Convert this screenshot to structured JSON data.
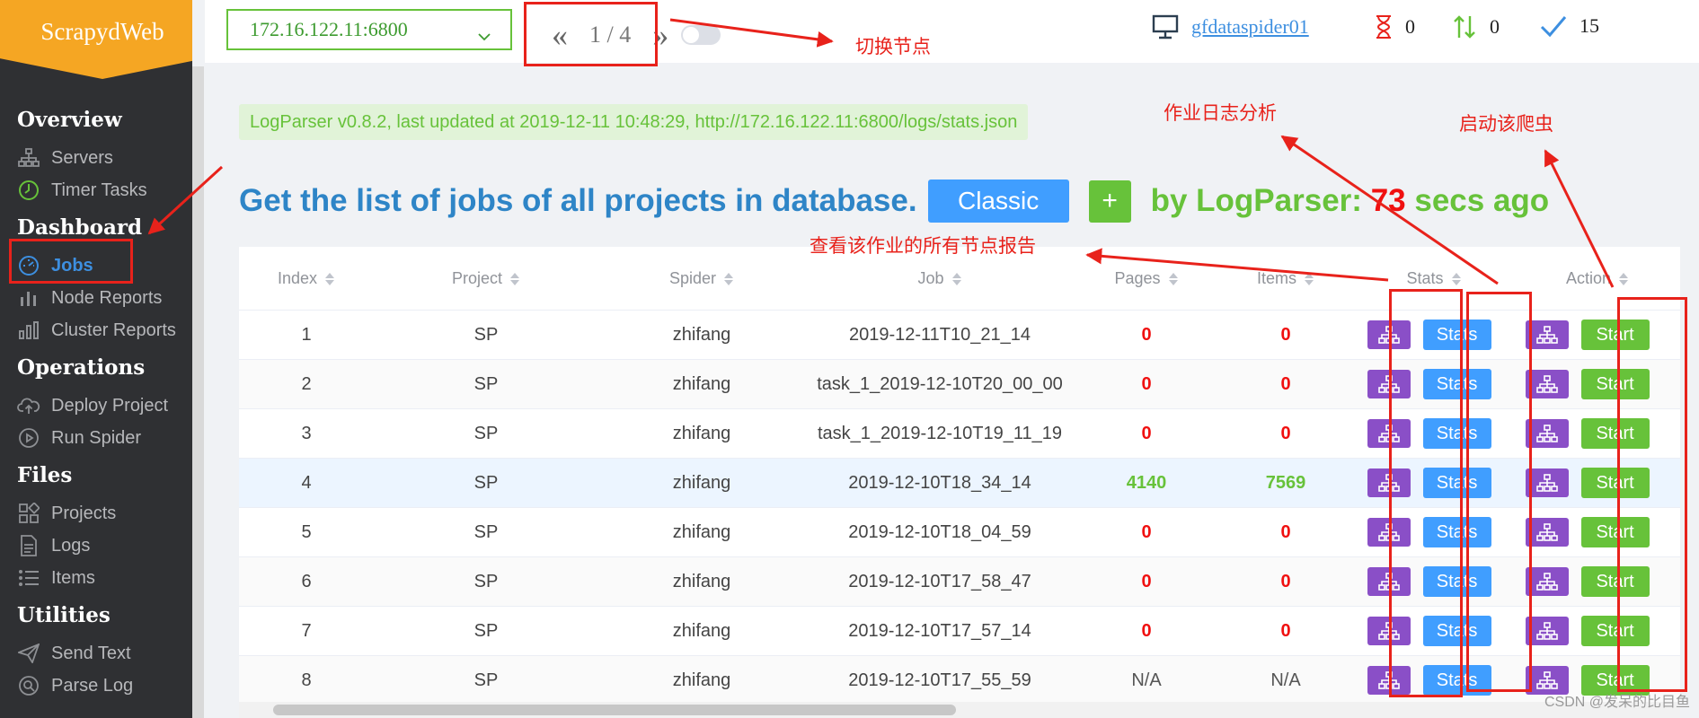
{
  "app": {
    "title": "ScrapydWeb"
  },
  "sidebar": {
    "groups": [
      {
        "label": "Overview",
        "items": [
          {
            "label": "Servers",
            "icon": "sitemap-icon"
          },
          {
            "label": "Timer Tasks",
            "icon": "timer-icon"
          }
        ]
      },
      {
        "label": "Dashboard",
        "items": [
          {
            "label": "Jobs",
            "icon": "dashboard-icon",
            "active": true
          },
          {
            "label": "Node Reports",
            "icon": "bar-chart-icon"
          },
          {
            "label": "Cluster Reports",
            "icon": "bar-chart-icon"
          }
        ]
      },
      {
        "label": "Operations",
        "items": [
          {
            "label": "Deploy Project",
            "icon": "upload-cloud-icon"
          },
          {
            "label": "Run Spider",
            "icon": "play-icon"
          }
        ]
      },
      {
        "label": "Files",
        "items": [
          {
            "label": "Projects",
            "icon": "grid-icon"
          },
          {
            "label": "Logs",
            "icon": "file-icon"
          },
          {
            "label": "Items",
            "icon": "list-icon"
          }
        ]
      },
      {
        "label": "Utilities",
        "items": [
          {
            "label": "Send Text",
            "icon": "send-icon"
          },
          {
            "label": "Parse Log",
            "icon": "search-icon"
          }
        ]
      }
    ]
  },
  "header": {
    "node_select": "172.16.122.11:6800",
    "pager": "1 / 4",
    "host": "gfdataspider01",
    "pending": "0",
    "running": "0",
    "finished": "15"
  },
  "banner": "LogParser v0.8.2, last updated at 2019-12-11 10:48:29, http://172.16.122.11:6800/logs/stats.json",
  "heading": {
    "title": "Get the list of jobs of all projects in database.",
    "classic": "Classic",
    "plus": "+",
    "parsed_prefix": "by LogParser:",
    "parsed_secs": "73",
    "parsed_suffix": "secs ago"
  },
  "table": {
    "columns": [
      "Index",
      "Project",
      "Spider",
      "Job",
      "Pages",
      "Items",
      "Stats",
      "Action"
    ],
    "stats_label": "Stats",
    "start_label": "Start",
    "rows": [
      {
        "index": "1",
        "project": "SP",
        "spider": "zhifang",
        "job": "2019-12-11T10_21_14",
        "pages": "0",
        "items": "0"
      },
      {
        "index": "2",
        "project": "SP",
        "spider": "zhifang",
        "job": "task_1_2019-12-10T20_00_00",
        "pages": "0",
        "items": "0"
      },
      {
        "index": "3",
        "project": "SP",
        "spider": "zhifang",
        "job": "task_1_2019-12-10T19_11_19",
        "pages": "0",
        "items": "0"
      },
      {
        "index": "4",
        "project": "SP",
        "spider": "zhifang",
        "job": "2019-12-10T18_34_14",
        "pages": "4140",
        "items": "7569"
      },
      {
        "index": "5",
        "project": "SP",
        "spider": "zhifang",
        "job": "2019-12-10T18_04_59",
        "pages": "0",
        "items": "0"
      },
      {
        "index": "6",
        "project": "SP",
        "spider": "zhifang",
        "job": "2019-12-10T17_58_47",
        "pages": "0",
        "items": "0"
      },
      {
        "index": "7",
        "project": "SP",
        "spider": "zhifang",
        "job": "2019-12-10T17_57_14",
        "pages": "0",
        "items": "0"
      },
      {
        "index": "8",
        "project": "SP",
        "spider": "zhifang",
        "job": "2019-12-10T17_55_59",
        "pages": "N/A",
        "items": "N/A"
      }
    ]
  },
  "annotations": {
    "switch_node": "切换节点",
    "job_log_analysis": "作业日志分析",
    "start_spider": "启动该爬虫",
    "view_reports": "查看该作业的所有节点报告"
  },
  "watermark": "CSDN @发呆的比目鱼"
}
